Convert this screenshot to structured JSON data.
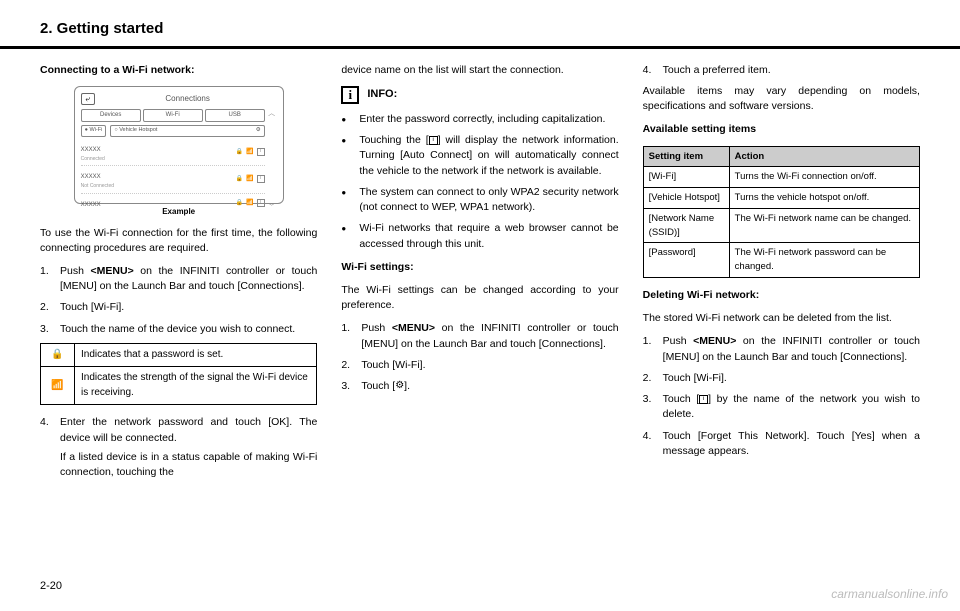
{
  "header": {
    "chapter": "2. Getting started",
    "page_number": "2-20"
  },
  "watermark": "carmanualsonline.info",
  "col1": {
    "heading": "Connecting to a Wi-Fi network:",
    "example_label": "Example",
    "screen": {
      "title": "Connections",
      "tabs": [
        "Devices",
        "Wi-Fi",
        "USB"
      ],
      "wifi_toggle": "● Wi-Fi",
      "hotspot_toggle": "○ Vehicle Hotspot",
      "nets": [
        {
          "name": "XXXXX",
          "sub": "Connected"
        },
        {
          "name": "XXXXX",
          "sub": "Not Connected"
        },
        {
          "name": "XXXXX",
          "sub": ""
        }
      ]
    },
    "intro": "To use the Wi-Fi connection for the first time, the following connecting procedures are required.",
    "steps": {
      "s1": {
        "n": "1.",
        "t": "Push <MENU> on the INFINITI controller or touch [MENU] on the Launch Bar and touch [Connections]."
      },
      "s2": {
        "n": "2.",
        "t": "Touch [Wi-Fi]."
      },
      "s3": {
        "n": "3.",
        "t": "Touch the name of the device you wish to connect."
      }
    },
    "icon_table": {
      "r1": "Indicates that a password is set.",
      "r2": "Indicates the strength of the signal the Wi-Fi device is receiving."
    },
    "step4": {
      "n": "4.",
      "t": "Enter the network password and touch [OK]. The device will be connected.",
      "sub": "If a listed device is in a status capable of making Wi-Fi connection, touching the"
    }
  },
  "col2": {
    "cont": "device name on the list will start the connection.",
    "info_label": "INFO:",
    "bullets": {
      "b1": "Enter the password correctly, including capitalization.",
      "b2": "Touching the [ i ] will display the network information. Turning [Auto Connect] on will automatically connect the vehicle to the network if the network is available.",
      "b3": "The system can connect to only WPA2 security network (not connect to WEP, WPA1 network).",
      "b4": "Wi-Fi networks that require a web browser cannot be accessed through this unit."
    },
    "settings_heading": "Wi-Fi settings:",
    "settings_intro": "The Wi-Fi settings can be changed according to your preference.",
    "steps": {
      "s1": {
        "n": "1.",
        "t": "Push <MENU> on the INFINITI controller or touch [MENU] on the Launch Bar and touch [Connections]."
      },
      "s2": {
        "n": "2.",
        "t": "Touch [Wi-Fi]."
      },
      "s3": {
        "n": "3.",
        "t": "Touch [⚙]."
      }
    }
  },
  "col3": {
    "step4": {
      "n": "4.",
      "t": "Touch a preferred item."
    },
    "note": "Available items may vary depending on models, specifications and software versions.",
    "avail_heading": "Available setting items",
    "table": {
      "h1": "Setting item",
      "h2": "Action",
      "rows": [
        {
          "a": "[Wi-Fi]",
          "b": "Turns the Wi-Fi connection on/off."
        },
        {
          "a": "[Vehicle Hotspot]",
          "b": "Turns the vehicle hotspot on/off."
        },
        {
          "a": "[Network Name (SSID)]",
          "b": "The Wi-Fi network name can be changed."
        },
        {
          "a": "[Password]",
          "b": "The Wi-Fi network password can be changed."
        }
      ]
    },
    "delete_heading": "Deleting Wi-Fi network:",
    "delete_intro": "The stored Wi-Fi network can be deleted from the list.",
    "steps": {
      "s1": {
        "n": "1.",
        "t": "Push <MENU> on the INFINITI controller or touch [MENU] on the Launch Bar and touch [Connections]."
      },
      "s2": {
        "n": "2.",
        "t": "Touch [Wi-Fi]."
      },
      "s3": {
        "n": "3.",
        "t": "Touch [ i ] by the name of the network you wish to delete."
      },
      "s4": {
        "n": "4.",
        "t": "Touch [Forget This Network]. Touch [Yes] when a message appears."
      }
    }
  }
}
